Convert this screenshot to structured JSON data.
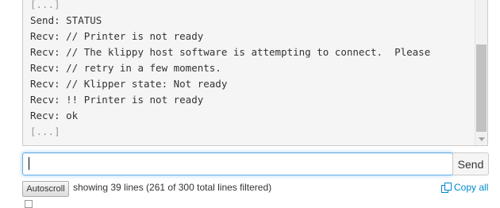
{
  "terminal": {
    "lines": [
      {
        "text": "[...]",
        "muted": true
      },
      {
        "text": "Send: STATUS",
        "muted": false
      },
      {
        "text": "Recv: // Printer is not ready",
        "muted": false
      },
      {
        "text": "Recv: // The klippy host software is attempting to connect.  Please",
        "muted": false
      },
      {
        "text": "Recv: // retry in a few moments.",
        "muted": false
      },
      {
        "text": "Recv: // Klipper state: Not ready",
        "muted": false
      },
      {
        "text": "Recv: !! Printer is not ready",
        "muted": false
      },
      {
        "text": "Recv: ok",
        "muted": false
      },
      {
        "text": "[...]",
        "muted": true
      }
    ]
  },
  "command": {
    "input_value": "",
    "send_label": "Send"
  },
  "footer": {
    "autoscroll_label": "Autoscroll",
    "status_text": "showing 39 lines (261 of 300 total lines filtered)",
    "copy_all_label": "Copy all"
  },
  "colors": {
    "link": "#0088cc",
    "focus_border": "#66afe9"
  },
  "icons": {
    "copy": "copy-icon"
  }
}
